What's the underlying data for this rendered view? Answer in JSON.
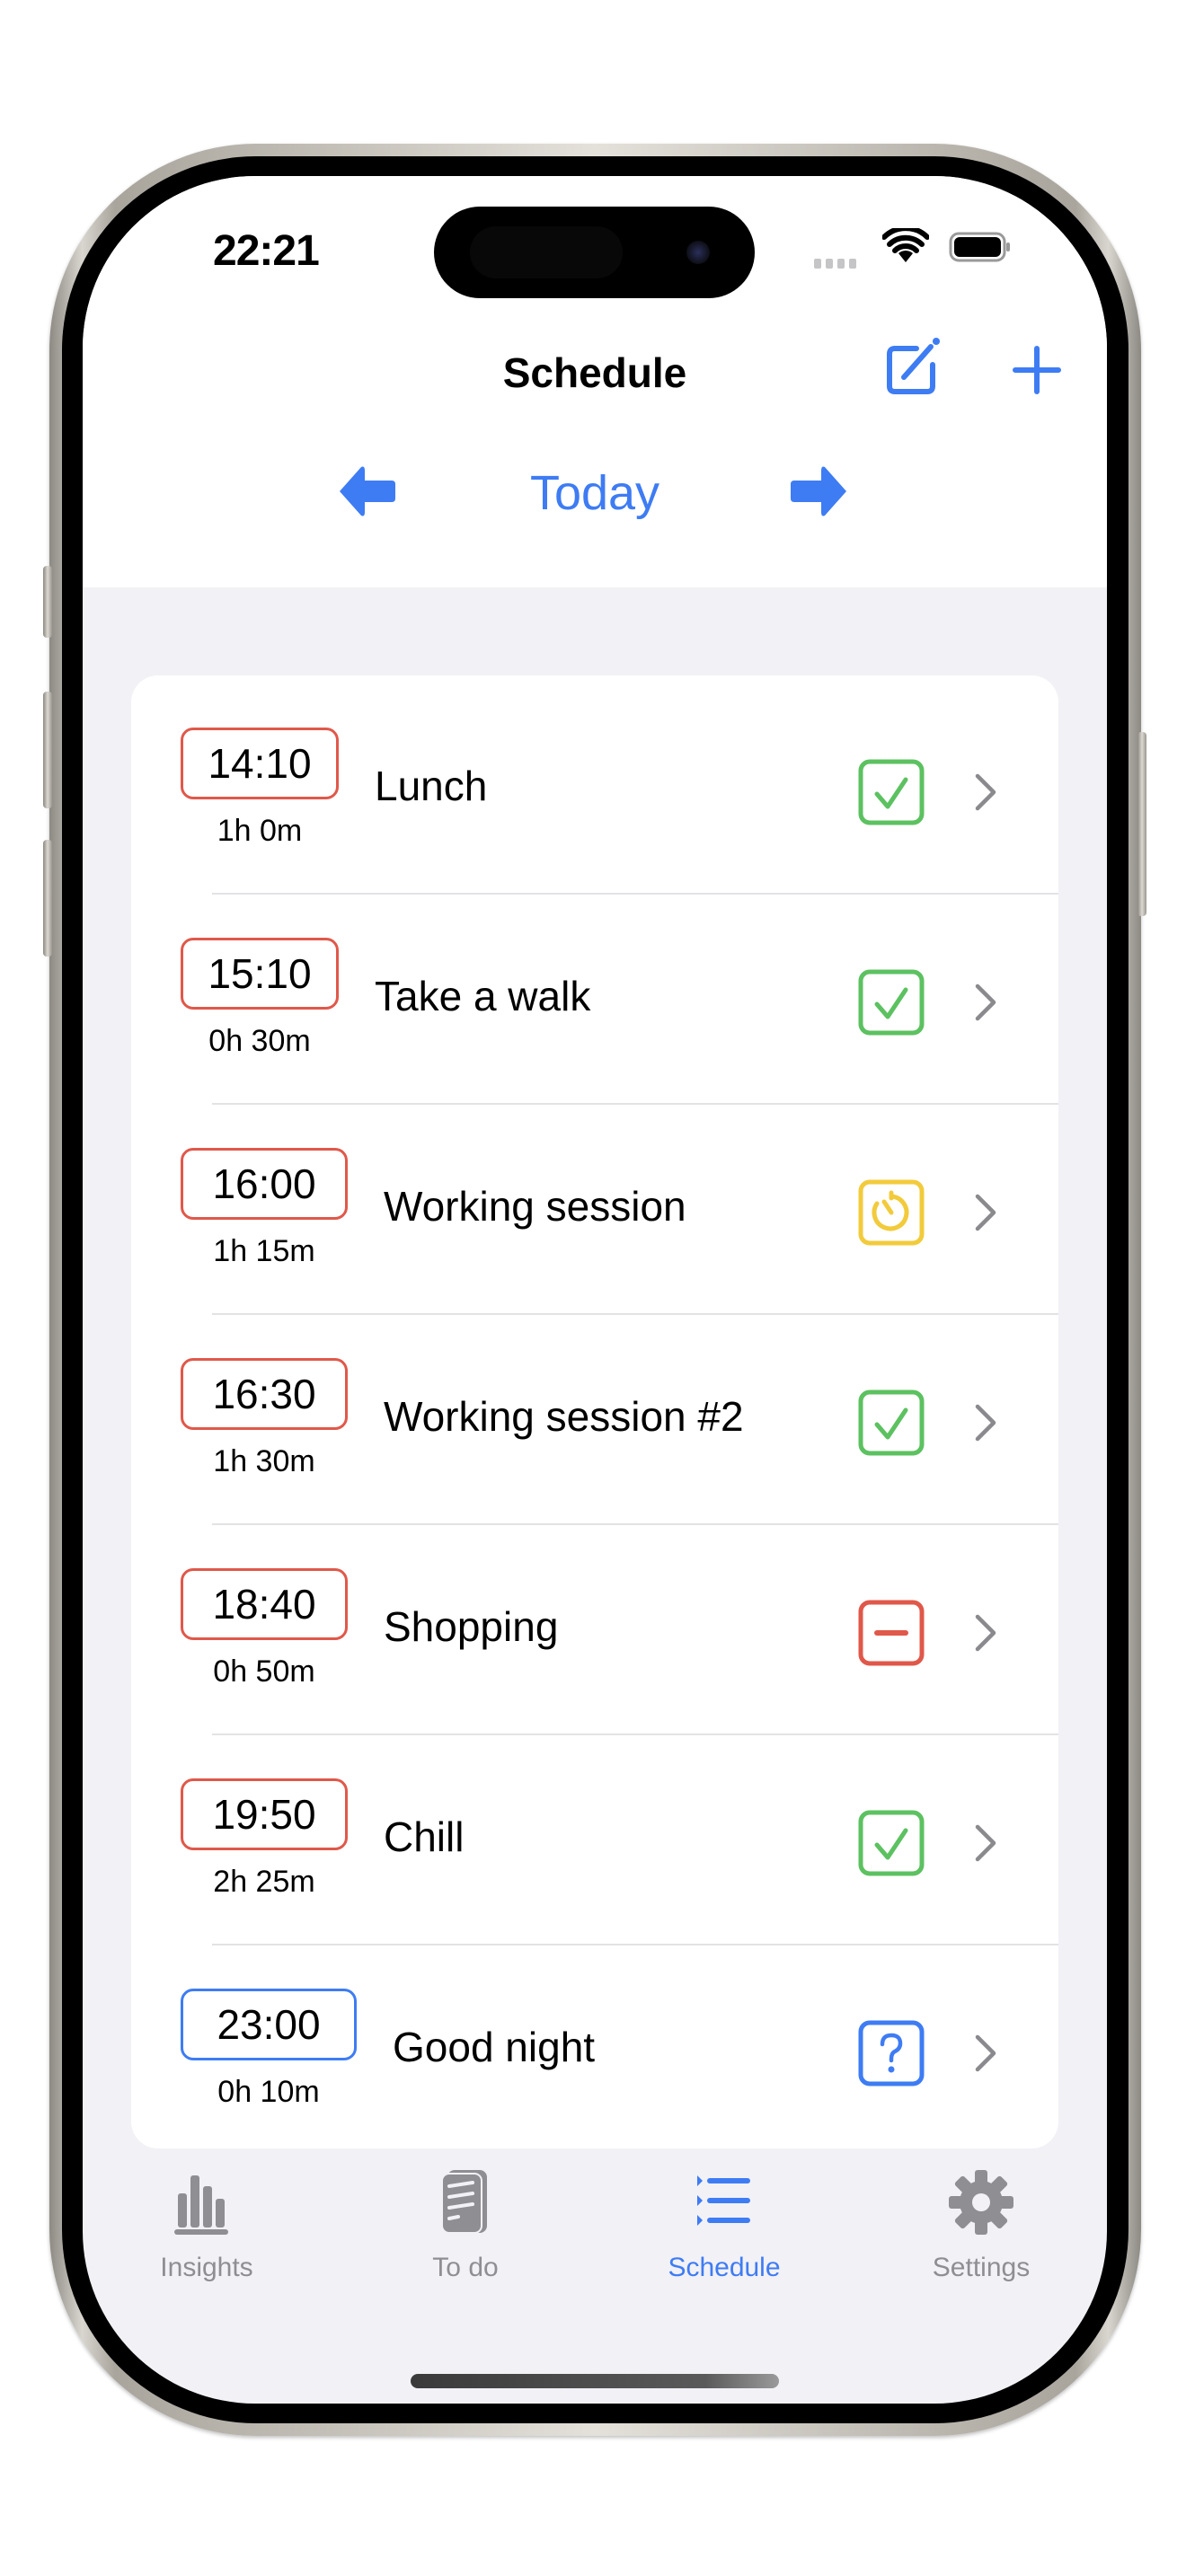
{
  "status_bar": {
    "time": "22:21"
  },
  "header": {
    "title": "Schedule",
    "edit_icon": "square-and-pencil-icon",
    "add_icon": "plus-icon",
    "date_nav": {
      "label": "Today",
      "prev_icon": "arrow-left-icon",
      "next_icon": "arrow-right-icon"
    }
  },
  "colors": {
    "accent": "#3E7CF3",
    "past_border": "#E0584A",
    "upcoming_border": "#3E7CF3",
    "done": "#5CC160",
    "in_progress": "#F2CB3C",
    "skipped": "#E0584A",
    "unknown": "#3E7CF3",
    "background": "#F2F1F6"
  },
  "schedule": [
    {
      "time": "14:10",
      "duration": "1h 0m",
      "title": "Lunch",
      "status": "done",
      "status_icon": "checkmark-square-icon",
      "time_state": "past"
    },
    {
      "time": "15:10",
      "duration": "0h 30m",
      "title": "Take a walk",
      "status": "done",
      "status_icon": "checkmark-square-icon",
      "time_state": "past"
    },
    {
      "time": "16:00",
      "duration": "1h 15m",
      "title": "Working session",
      "status": "in-progress",
      "status_icon": "timer-square-icon",
      "time_state": "past"
    },
    {
      "time": "16:30",
      "duration": "1h 30m",
      "title": "Working session #2",
      "status": "done",
      "status_icon": "checkmark-square-icon",
      "time_state": "past"
    },
    {
      "time": "18:40",
      "duration": "0h 50m",
      "title": "Shopping",
      "status": "skipped",
      "status_icon": "minus-square-icon",
      "time_state": "past"
    },
    {
      "time": "19:50",
      "duration": "2h 25m",
      "title": "Chill",
      "status": "done",
      "status_icon": "checkmark-square-icon",
      "time_state": "past"
    },
    {
      "time": "23:00",
      "duration": "0h 10m",
      "title": "Good night",
      "status": "unknown",
      "status_icon": "questionmark-square-icon",
      "time_state": "upcoming"
    }
  ],
  "tabbar": {
    "tabs": [
      {
        "label": "Insights",
        "icon": "chart-bar-icon",
        "active": false
      },
      {
        "label": "To do",
        "icon": "document-icon",
        "active": false
      },
      {
        "label": "Schedule",
        "icon": "list-bullet-icon",
        "active": true
      },
      {
        "label": "Settings",
        "icon": "gear-icon",
        "active": false
      }
    ]
  }
}
